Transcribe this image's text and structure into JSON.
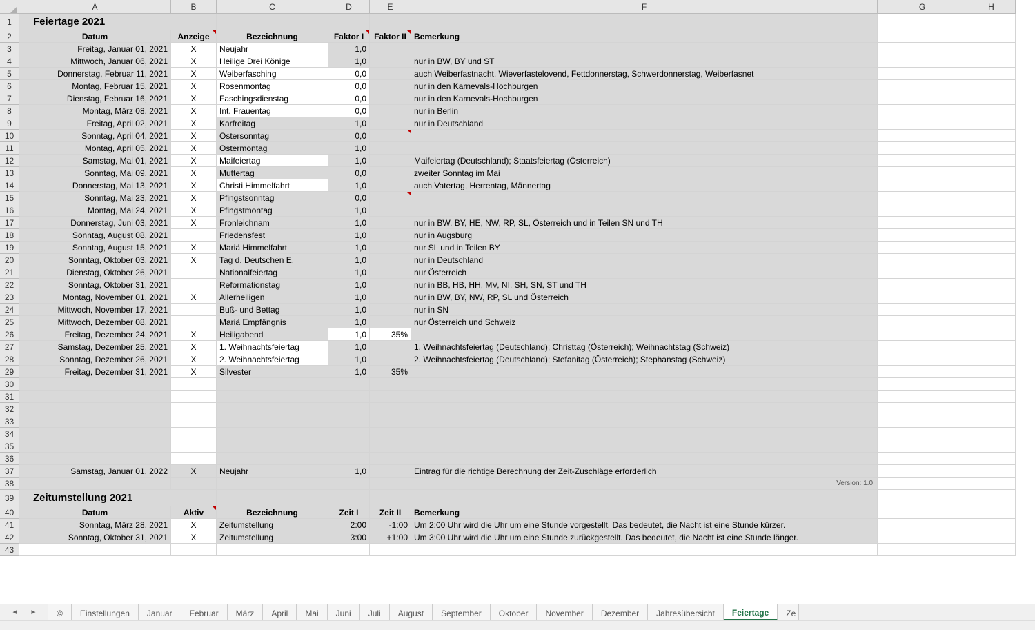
{
  "columns": [
    "A",
    "B",
    "C",
    "D",
    "E",
    "F",
    "G",
    "H"
  ],
  "section1_title": "Feiertage 2021",
  "headers1": {
    "A": "Datum",
    "B": "Anzeige",
    "C": "Bezeichnung",
    "D": "Faktor I",
    "E": "Faktor II",
    "F": "Bemerkung"
  },
  "holidays": [
    {
      "date": "Freitag, Januar 01, 2021",
      "show": "X",
      "name": "Neujahr",
      "f1": "1,0",
      "f2": "",
      "note": "",
      "white_c": true
    },
    {
      "date": "Mittwoch, Januar 06, 2021",
      "show": "X",
      "name": "Heilige Drei Könige",
      "f1": "1,0",
      "f2": "",
      "note": "nur in BW, BY und ST",
      "white_c": true
    },
    {
      "date": "Donnerstag, Februar 11, 2021",
      "show": "X",
      "name": "Weiberfasching",
      "f1": "0,0",
      "f2": "",
      "note": "auch Weiberfastnacht, Wieverfastelovend, Fettdonnerstag, Schwerdonnerstag, Weiberfasnet",
      "white_c": true,
      "white_d": true
    },
    {
      "date": "Montag, Februar 15, 2021",
      "show": "X",
      "name": "Rosenmontag",
      "f1": "0,0",
      "f2": "",
      "note": "nur in den Karnevals-Hochburgen",
      "white_c": true,
      "white_d": true
    },
    {
      "date": "Dienstag, Februar 16, 2021",
      "show": "X",
      "name": "Faschingsdienstag",
      "f1": "0,0",
      "f2": "",
      "note": "nur in den Karnevals-Hochburgen",
      "white_c": true,
      "white_d": true
    },
    {
      "date": "Montag, März 08, 2021",
      "show": "X",
      "name": "Int. Frauentag",
      "f1": "0,0",
      "f2": "",
      "note": "nur in Berlin",
      "white_c": true,
      "white_d": true
    },
    {
      "date": "Freitag, April 02, 2021",
      "show": "X",
      "name": "Karfreitag",
      "f1": "1,0",
      "f2": "",
      "note": "nur in Deutschland"
    },
    {
      "date": "Sonntag, April 04, 2021",
      "show": "X",
      "name": "Ostersonntag",
      "f1": "0,0",
      "f2": "",
      "note": "",
      "mark_e": true
    },
    {
      "date": "Montag, April 05, 2021",
      "show": "X",
      "name": "Ostermontag",
      "f1": "1,0",
      "f2": "",
      "note": ""
    },
    {
      "date": "Samstag, Mai 01, 2021",
      "show": "X",
      "name": "Maifeiertag",
      "f1": "1,0",
      "f2": "",
      "note": "Maifeiertag (Deutschland); Staatsfeiertag (Österreich)",
      "white_c": true
    },
    {
      "date": "Sonntag, Mai 09, 2021",
      "show": "X",
      "name": "Muttertag",
      "f1": "0,0",
      "f2": "",
      "note": "zweiter Sonntag im Mai"
    },
    {
      "date": "Donnerstag, Mai 13, 2021",
      "show": "X",
      "name": "Christi Himmelfahrt",
      "f1": "1,0",
      "f2": "",
      "note": "auch Vatertag, Herrentag, Männertag",
      "white_c": true
    },
    {
      "date": "Sonntag, Mai 23, 2021",
      "show": "X",
      "name": "Pfingstsonntag",
      "f1": "0,0",
      "f2": "",
      "note": "",
      "mark_e": true
    },
    {
      "date": "Montag, Mai 24, 2021",
      "show": "X",
      "name": "Pfingstmontag",
      "f1": "1,0",
      "f2": "",
      "note": ""
    },
    {
      "date": "Donnerstag, Juni 03, 2021",
      "show": "X",
      "name": "Fronleichnam",
      "f1": "1,0",
      "f2": "",
      "note": "nur in BW, BY, HE, NW, RP, SL, Österreich und in Teilen SN und TH"
    },
    {
      "date": "Sonntag, August 08, 2021",
      "show": "",
      "name": "Friedensfest",
      "f1": "1,0",
      "f2": "",
      "note": "nur in Augsburg"
    },
    {
      "date": "Sonntag, August 15, 2021",
      "show": "X",
      "name": "Mariä Himmelfahrt",
      "f1": "1,0",
      "f2": "",
      "note": "nur SL und in Teilen BY"
    },
    {
      "date": "Sonntag, Oktober 03, 2021",
      "show": "X",
      "name": "Tag d. Deutschen E.",
      "f1": "1,0",
      "f2": "",
      "note": "nur in Deutschland"
    },
    {
      "date": "Dienstag, Oktober 26, 2021",
      "show": "",
      "name": "Nationalfeiertag",
      "f1": "1,0",
      "f2": "",
      "note": "nur Österreich"
    },
    {
      "date": "Sonntag, Oktober 31, 2021",
      "show": "",
      "name": "Reformationstag",
      "f1": "1,0",
      "f2": "",
      "note": "nur in BB, HB, HH, MV, NI, SH, SN, ST und TH"
    },
    {
      "date": "Montag, November 01, 2021",
      "show": "X",
      "name": "Allerheiligen",
      "f1": "1,0",
      "f2": "",
      "note": "nur in BW, BY, NW, RP, SL und Österreich"
    },
    {
      "date": "Mittwoch, November 17, 2021",
      "show": "",
      "name": "Buß- und Bettag",
      "f1": "1,0",
      "f2": "",
      "note": "nur in SN"
    },
    {
      "date": "Mittwoch, Dezember 08, 2021",
      "show": "",
      "name": "Mariä Empfängnis",
      "f1": "1,0",
      "f2": "",
      "note": "nur Österreich und Schweiz"
    },
    {
      "date": "Freitag, Dezember 24, 2021",
      "show": "X",
      "name": "Heiligabend",
      "f1": "1,0",
      "f2": "35%",
      "note": "",
      "white_d": true,
      "white_e": true
    },
    {
      "date": "Samstag, Dezember 25, 2021",
      "show": "X",
      "name": "1. Weihnachtsfeiertag",
      "f1": "1,0",
      "f2": "",
      "note": "1. Weihnachtsfeiertag (Deutschland); Christtag (Österreich); Weihnachtstag (Schweiz)",
      "white_c": true
    },
    {
      "date": "Sonntag, Dezember 26, 2021",
      "show": "X",
      "name": "2. Weihnachtsfeiertag",
      "f1": "1,0",
      "f2": "",
      "note": "2. Weihnachtsfeiertag (Deutschland); Stefanitag (Österreich); Stephanstag (Schweiz)",
      "white_c": true
    },
    {
      "date": "Freitag, Dezember 31, 2021",
      "show": "X",
      "name": "Silvester",
      "f1": "1,0",
      "f2": "35%",
      "note": ""
    }
  ],
  "empty_rows": [
    30,
    31,
    32,
    33,
    34,
    35,
    36
  ],
  "row37": {
    "date": "Samstag, Januar 01, 2022",
    "show": "X",
    "name": "Neujahr",
    "f1": "1,0",
    "f2": "",
    "note": "Eintrag für die richtige Berechnung der Zeit-Zuschläge erforderlich"
  },
  "version_text": "Version: 1.0",
  "section2_title": "Zeitumstellung 2021",
  "headers2": {
    "A": "Datum",
    "B": "Aktiv",
    "C": "Bezeichnung",
    "D": "Zeit I",
    "E": "Zeit II",
    "F": "Bemerkung"
  },
  "dst": [
    {
      "date": "Sonntag, März 28, 2021",
      "active": "X",
      "name": "Zeitumstellung",
      "t1": "2:00",
      "t2": "-1:00",
      "note": "Um 2:00 Uhr wird die Uhr um eine Stunde vorgestellt. Das bedeutet, die Nacht ist eine Stunde kürzer."
    },
    {
      "date": "Sonntag, Oktober 31, 2021",
      "active": "X",
      "name": "Zeitumstellung",
      "t1": "3:00",
      "t2": "+1:00",
      "note": "Um 3:00 Uhr wird die Uhr um eine Stunde zurückgestellt. Das bedeutet, die Nacht ist eine Stunde länger."
    }
  ],
  "sheet_tabs": [
    "©",
    "Einstellungen",
    "Januar",
    "Februar",
    "März",
    "April",
    "Mai",
    "Juni",
    "Juli",
    "August",
    "September",
    "Oktober",
    "November",
    "Dezember",
    "Jahresübersicht",
    "Feiertage",
    "Ze"
  ],
  "active_tab": "Feiertage"
}
